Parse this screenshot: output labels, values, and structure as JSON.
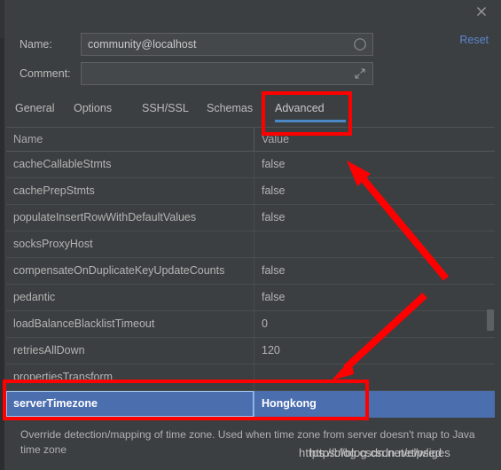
{
  "window": {
    "close_icon": "close-icon"
  },
  "form": {
    "name_label": "Name:",
    "name_value": "community@localhost",
    "name_icon": "circle-indicator-icon",
    "comment_label": "Comment:",
    "comment_value": "",
    "comment_placeholder": "",
    "comment_icon": "expand-icon",
    "reset_label": "Reset"
  },
  "tabs": [
    {
      "label": "General",
      "active": false
    },
    {
      "label": "Options",
      "active": false
    },
    {
      "label": "SSH/SSL",
      "active": false
    },
    {
      "label": "Schemas",
      "active": false
    },
    {
      "label": "Advanced",
      "active": true
    }
  ],
  "table": {
    "columns": [
      "Name",
      "Value"
    ],
    "rows": [
      {
        "name": "cacheCallableStmts",
        "value": "false",
        "selected": false
      },
      {
        "name": "cachePrepStmts",
        "value": "false",
        "selected": false
      },
      {
        "name": "populateInsertRowWithDefaultValues",
        "value": "false",
        "selected": false
      },
      {
        "name": "socksProxyHost",
        "value": "",
        "selected": false
      },
      {
        "name": "compensateOnDuplicateKeyUpdateCounts",
        "value": "false",
        "selected": false
      },
      {
        "name": "pedantic",
        "value": "false",
        "selected": false
      },
      {
        "name": "loadBalanceBlacklistTimeout",
        "value": "0",
        "selected": false
      },
      {
        "name": "retriesAllDown",
        "value": "120",
        "selected": false
      },
      {
        "name": "propertiesTransform",
        "value": "",
        "selected": false
      },
      {
        "name": "serverTimezone",
        "value": "Hongkong",
        "selected": true
      }
    ]
  },
  "description": "Override detection/mapping of time zone. Used when time zone from server doesn't map to Java time zone",
  "watermark": {
    "line_a": "https://blog.csdn.net/elpsed",
    "line_b": "https://blog.csdn.net/wliges"
  },
  "colors": {
    "accent": "#4a88c7",
    "selection": "#4b6eaf",
    "annotation": "#fe0000",
    "link": "#5a87cf",
    "background": "#3c3f41"
  }
}
